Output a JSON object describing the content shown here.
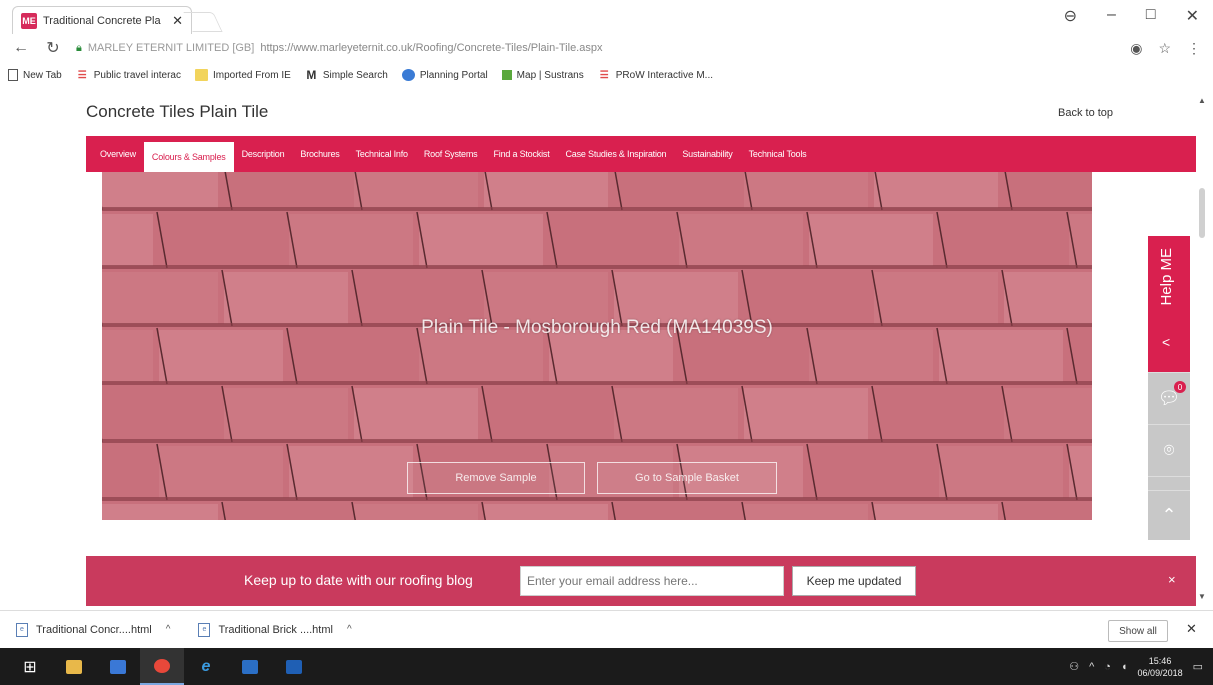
{
  "browser": {
    "tab_title": "Traditional Concrete Pla",
    "favicon_text": "ME",
    "window_controls": [
      "⊖",
      "–",
      "□",
      "✕"
    ],
    "org_label": "MARLEY ETERNIT LIMITED [GB]",
    "url": "https://www.marleyeternit.co.uk/Roofing/Concrete-Tiles/Plain-Tile.aspx",
    "bookmarks": [
      {
        "label": "New Tab",
        "icon": "page-icon"
      },
      {
        "label": "Public travel interac",
        "icon": "grid-icon"
      },
      {
        "label": "Imported From IE",
        "icon": "folder-icon"
      },
      {
        "label": "Simple Search",
        "icon": "m-icon"
      },
      {
        "label": "Planning Portal",
        "icon": "globe-icon"
      },
      {
        "label": "Map | Sustrans",
        "icon": "map-icon"
      },
      {
        "label": "PRoW Interactive M...",
        "icon": "grid-icon"
      }
    ]
  },
  "page": {
    "title": "Concrete Tiles  Plain Tile",
    "back_to_top": "Back to top",
    "nav": [
      {
        "label": "Overview",
        "active": false
      },
      {
        "label": "Colours & Samples",
        "active": true
      },
      {
        "label": "Description",
        "active": false
      },
      {
        "label": "Brochures",
        "active": false
      },
      {
        "label": "Technical Info",
        "active": false
      },
      {
        "label": "Roof Systems",
        "active": false
      },
      {
        "label": "Find a Stockist",
        "active": false
      },
      {
        "label": "Case Studies & Inspiration",
        "active": false
      },
      {
        "label": "Sustainability",
        "active": false
      },
      {
        "label": "Technical Tools",
        "active": false
      }
    ],
    "hero": {
      "caption": "Plain Tile - Mosborough Red (MA14039S)",
      "remove_sample": "Remove Sample",
      "go_to_basket": "Go to Sample Basket",
      "tile_color": "#c8707c"
    },
    "help": {
      "label": "Help ME",
      "chevron": "<",
      "chat_badge": "0"
    },
    "newsletter": {
      "text": "Keep up to date with our roofing blog",
      "placeholder": "Enter your email address here...",
      "button": "Keep me updated",
      "close": "×"
    }
  },
  "downloads": {
    "items": [
      {
        "label": "Traditional Concr....html"
      },
      {
        "label": "Traditional Brick ....html"
      }
    ],
    "show_all": "Show all",
    "close": "✕"
  },
  "taskbar": {
    "time": "15:46",
    "date": "06/09/2018"
  },
  "colors": {
    "brand": "#d9204f",
    "newsletter": "#c93a5d"
  }
}
